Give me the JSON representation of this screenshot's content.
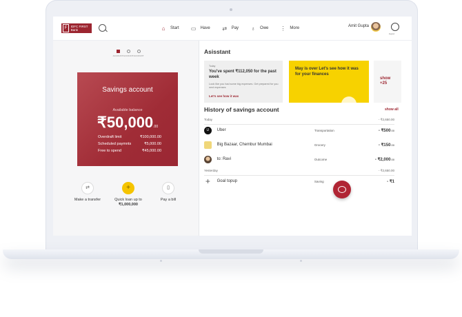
{
  "header": {
    "logo_text": "IDFC FIRST Bank",
    "nav": [
      {
        "label": "Start",
        "icon": "home-icon"
      },
      {
        "label": "Have",
        "icon": "wallet-icon"
      },
      {
        "label": "Pay",
        "icon": "transfer-arrows-icon"
      },
      {
        "label": "Owe",
        "icon": "money-bag-icon"
      },
      {
        "label": "More",
        "icon": "more-vertical-icon"
      }
    ],
    "user_name": "Amit Gupta",
    "logout_label": "logout"
  },
  "left": {
    "pager": [
      "ACCOUNT",
      "ACCOUNT",
      "ACCOUNT"
    ],
    "card": {
      "title": "Savings account",
      "available_label": "Available balance",
      "balance": "₹50,000",
      "balance_decimals": ".00",
      "lines": [
        {
          "label": "Overdraft limit",
          "value": "₹100,000.00"
        },
        {
          "label": "Scheduled paymnts",
          "value": "₹5,000.00"
        },
        {
          "label": "Free to spend",
          "value": "₹45,000.00"
        }
      ]
    },
    "actions": {
      "transfer": "Make a transfer",
      "loan_line1": "Quick loan up to",
      "loan_line2": "₹1,000,000",
      "bill": "Pay a bill"
    }
  },
  "right": {
    "assistant_title": "Asisstant",
    "card1": {
      "tag": "Today",
      "headline": "You've spent ₹112,050 for the past week",
      "desc": "Look like you had some big expenses. Get prepared for you next expenses",
      "link": "Let's see how it was"
    },
    "card2": {
      "headline": "May is over Let's see how it was for your finances"
    },
    "card3": {
      "show": "show",
      "count": "+25"
    },
    "history_title": "History of savings account",
    "show_all": "show all",
    "groups": [
      {
        "label": "Today",
        "total": "- ₹2,650.00",
        "rows": [
          {
            "name": "Uber",
            "category": "Transportation",
            "amount": "- ₹500",
            "dec": ".00"
          },
          {
            "name": "Big Bazaar, Chembur Mumbai",
            "category": "Grocery",
            "amount": "- ₹150",
            "dec": ".00"
          },
          {
            "name": "to: Ravi",
            "category": "Outcome",
            "amount": "- ₹2,000",
            "dec": ".00"
          }
        ]
      },
      {
        "label": "Yesterday",
        "total": "- ₹2,650.00",
        "rows": [
          {
            "name": "Goal topup",
            "category": "Saving",
            "amount": "- ₹1",
            "dec": ""
          }
        ]
      }
    ]
  }
}
